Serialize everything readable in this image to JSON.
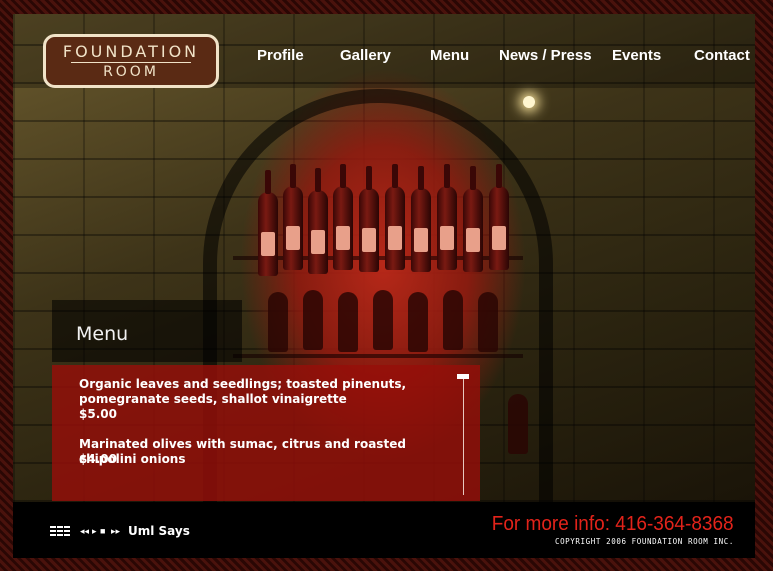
{
  "brand": {
    "logo_line1": "FOUNDATION",
    "logo_line2": "ROOM"
  },
  "nav": [
    {
      "label": "Profile"
    },
    {
      "label": "Gallery"
    },
    {
      "label": "Menu"
    },
    {
      "label": "News / Press"
    },
    {
      "label": "Events"
    },
    {
      "label": "Contact"
    }
  ],
  "menu": {
    "title": "Menu",
    "items": [
      {
        "name": "Organic leaves and seedlings; toasted pinenuts, pomegranate seeds, shallot vinaigrette",
        "price": "$5.00"
      },
      {
        "name": "Marinated olives with sumac, citrus and roasted chipolini onions",
        "price": "$4.00"
      }
    ]
  },
  "player": {
    "icons": [
      "playlist-grid-icon",
      "rewind-icon",
      "play-icon",
      "stop-icon",
      "fast-forward-icon"
    ],
    "controls": {
      "rewind": "◂◂",
      "play": "▸",
      "stop": "■",
      "forward": "▸▸"
    },
    "track": "Uml Says"
  },
  "footer": {
    "info": "For more info: 416-364-8368",
    "copyright": "COPYRIGHT 2006 FOUNDATION ROOM INC."
  },
  "colors": {
    "accent": "#e2231a",
    "panel": "#96100a",
    "logo_border": "#f1e3c8"
  }
}
